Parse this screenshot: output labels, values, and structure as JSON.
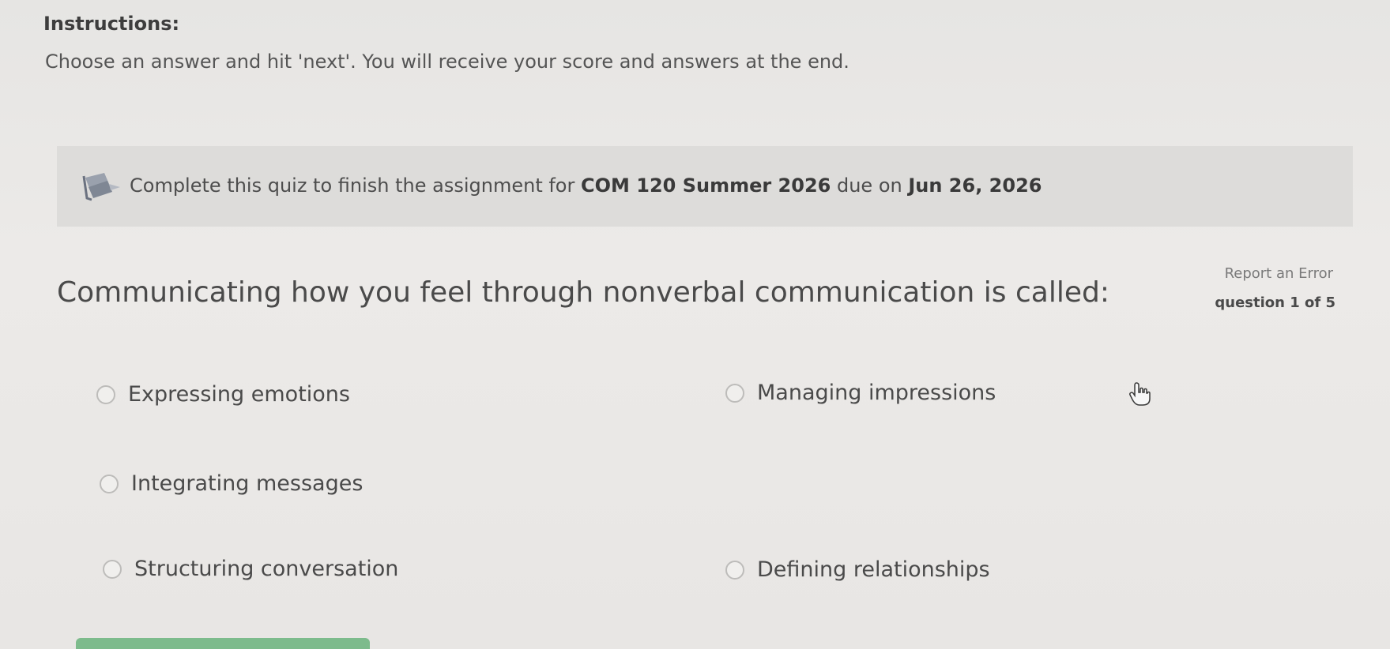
{
  "instructions": {
    "heading": "Instructions:",
    "text": "Choose an answer and hit 'next'. You will receive your score and answers at the end."
  },
  "notice": {
    "icon": "assignment-icon",
    "prefix": "Complete this quiz to finish the assignment for ",
    "course": "COM 120 Summer 2026",
    "middle": " due on ",
    "due_date": "Jun 26, 2026"
  },
  "question": {
    "text": "Communicating how you feel through nonverbal communication is called:",
    "report_label": "Report an Error",
    "counter": "question 1 of 5"
  },
  "answers": [
    "Expressing emotions",
    "Managing impressions",
    "Integrating messages",
    "Structuring conversation",
    "Defining relationships"
  ],
  "colors": {
    "next_button": "#7dbb8c",
    "notice_background": "#dddcda"
  }
}
